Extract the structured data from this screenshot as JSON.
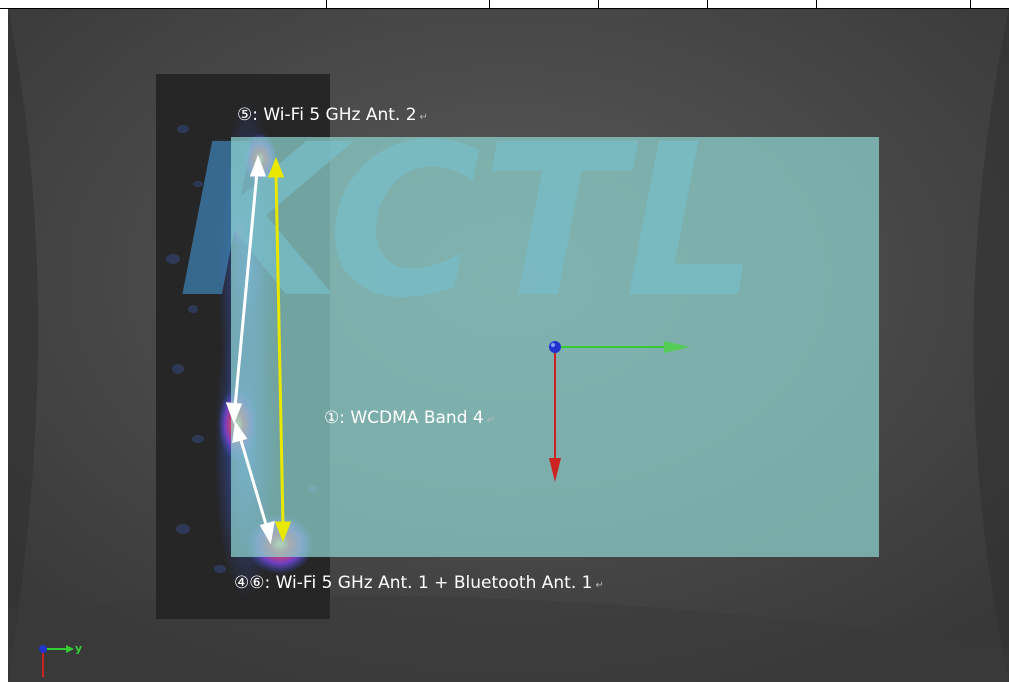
{
  "labels": {
    "antenna_5": "⑤: Wi-Fi 5 GHz Ant. 2",
    "antenna_1": "①: WCDMA Band 4",
    "antenna_46": "④⑥: Wi-Fi 5 GHz Ant. 1 + Bluetooth Ant. 1"
  },
  "watermark": "KCTL",
  "axis_triad": {
    "y_label": "y"
  },
  "paragraph_mark": "↵",
  "colors": {
    "viewport_bg": "#4a4a4a",
    "device_overlay": "#8fd4d0",
    "watermark": "#3d7fb0",
    "arrow_white": "#ffffff",
    "arrow_yellow": "#e8e800",
    "axis_x": "#33cc33",
    "axis_z": "#cc2222",
    "origin": "#2233cc"
  },
  "icons": [
    "origin-sphere-icon",
    "x-axis-arrow-icon",
    "z-axis-arrow-icon",
    "axis-triad-icon"
  ]
}
